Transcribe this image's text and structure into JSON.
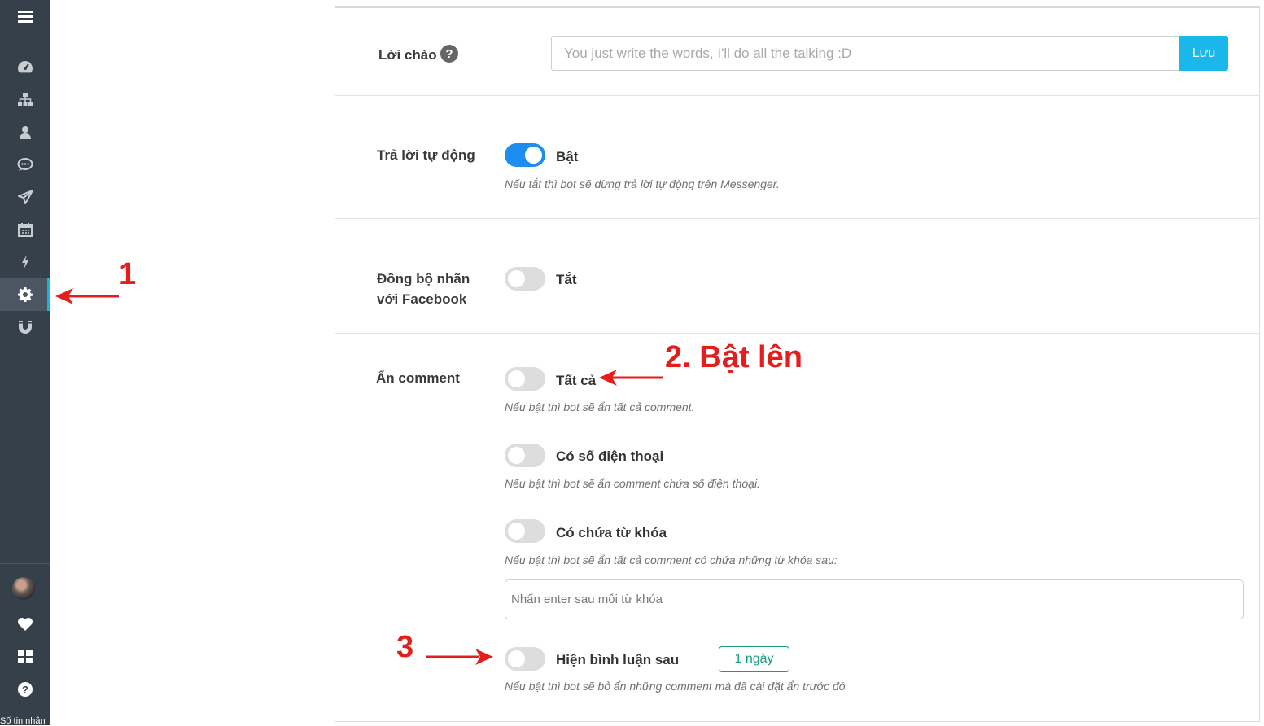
{
  "sidebar": {
    "items": [
      {
        "icon": "menu-icon"
      },
      {
        "icon": "dashboard-icon"
      },
      {
        "icon": "sitemap-icon"
      },
      {
        "icon": "user-icon"
      },
      {
        "icon": "chat-icon"
      },
      {
        "icon": "paper-plane-icon"
      },
      {
        "icon": "calendar-icon"
      },
      {
        "icon": "bolt-icon"
      },
      {
        "icon": "gear-icon",
        "active": true
      },
      {
        "icon": "magnet-icon"
      }
    ],
    "bottom_items": [
      {
        "icon": "avatar"
      },
      {
        "icon": "heart-icon"
      },
      {
        "icon": "grid-icon"
      },
      {
        "icon": "question-icon"
      }
    ],
    "footnote": "Số tin nhắn"
  },
  "greeting": {
    "label": "Lời chào",
    "placeholder": "You just write the words, I'll do all the talking :D",
    "save_label": "Lưu"
  },
  "auto_reply": {
    "label": "Trả lời tự động",
    "toggle_state": "on",
    "toggle_label": "Bật",
    "hint": "Nếu tắt thì bot sẽ dừng trả lời tự động trên Messenger."
  },
  "sync_labels": {
    "label_line1": "Đồng bộ nhãn",
    "label_line2": "với Facebook",
    "toggle_state": "off",
    "toggle_label": "Tắt"
  },
  "hide_comment": {
    "label": "Ẩn comment",
    "all": {
      "toggle_label": "Tất cả",
      "hint": "Nếu bật thì bot sẽ ẩn tất cả comment."
    },
    "phone": {
      "toggle_label": "Có số điện thoại",
      "hint": "Nếu bật thì bot sẽ ẩn comment chứa số điện thoại."
    },
    "keyword": {
      "toggle_label": "Có chứa từ khóa",
      "hint": "Nếu bật thì bot sẽ ẩn tất cả comment có chứa những từ khóa sau:",
      "input_placeholder": "Nhấn enter sau mỗi từ khóa"
    },
    "show_after": {
      "toggle_label": "Hiện bình luận sau",
      "days_label": "1 ngày",
      "hint": "Nếu bật thì bot sẽ bỏ ẩn những comment mà đã cài đặt ẩn trước đó"
    }
  },
  "annotations": {
    "step1": "1",
    "step2": "2. Bật lên",
    "step3": "3",
    "color": "#e41d1d"
  },
  "colors": {
    "sidebar_bg": "#36404a",
    "accent": "#11b6e6",
    "toggle_on": "#1c8ef0",
    "days_button": "#1a9c79"
  }
}
